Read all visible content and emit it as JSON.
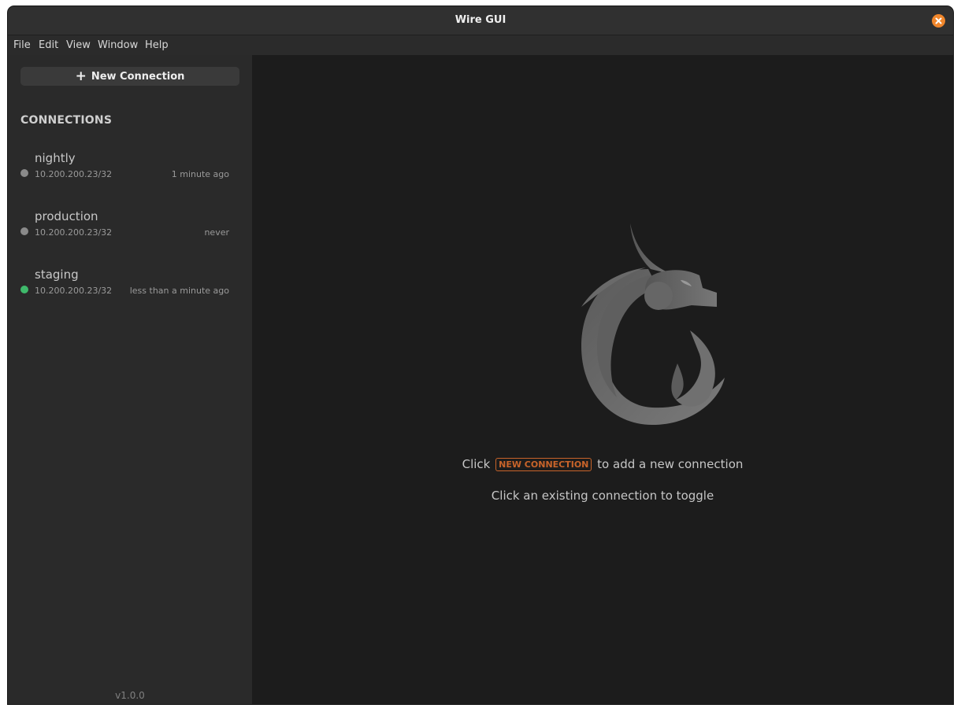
{
  "window": {
    "title": "Wire GUI"
  },
  "menu": [
    "File",
    "Edit",
    "View",
    "Window",
    "Help"
  ],
  "sidebar": {
    "new_connection_label": "New Connection",
    "section_title": "CONNECTIONS",
    "connections": [
      {
        "name": "nightly",
        "address": "10.200.200.23/32",
        "last_connected": "1 minute ago",
        "status": "inactive"
      },
      {
        "name": "production",
        "address": "10.200.200.23/32",
        "last_connected": "never",
        "status": "inactive"
      },
      {
        "name": "staging",
        "address": "10.200.200.23/32",
        "last_connected": "less than a minute ago",
        "status": "active"
      }
    ],
    "version": "v1.0.0"
  },
  "main": {
    "hint_prefix": "Click",
    "hint_badge": "NEW CONNECTION",
    "hint_suffix": "to add a new connection",
    "hint_toggle": "Click an existing connection to toggle"
  },
  "colors": {
    "accent": "#f0862b",
    "badge": "#c8642a",
    "status_active": "#3fb96b",
    "status_inactive": "#8a8a8a"
  }
}
